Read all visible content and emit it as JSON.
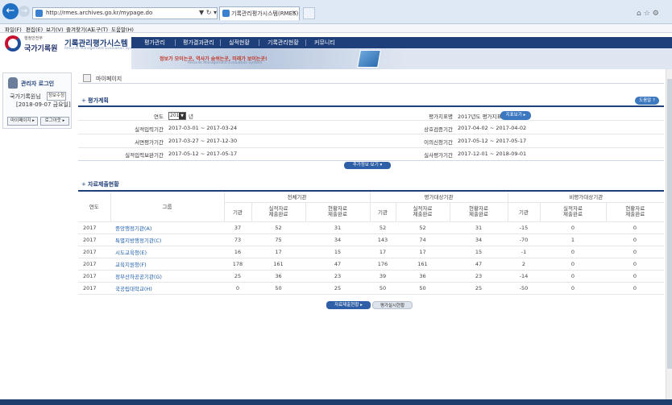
{
  "browser": {
    "url": "http://rmes.archives.go.kr/mypage.do",
    "addr_tools": "▼ ↻ ▾ ↺",
    "tab_title": "기록관리평가시스템(RMES)",
    "menu": [
      "파일(F)",
      "편집(E)",
      "보기(V)",
      "즐겨찾기(A)",
      "도구(T)",
      "도움말(H)"
    ],
    "window_icons": "⌂☆⚙"
  },
  "header": {
    "logo_top": "행정안전부",
    "logo_main": "국가기록원",
    "system_title": "기록관리평가시스템",
    "system_subtitle": "Records Management Evaluation System",
    "nav": [
      "평가관리",
      "평가결과관리",
      "실적현황",
      "기록관리현황",
      "커뮤니티"
    ],
    "banner_text": "정보가 모이는곳, 역사가 숨쉬는곳, 미래가 보이는곳!",
    "banner_sub": "Records Management Evaluation System"
  },
  "sidebar": {
    "title": "관리자 로그인",
    "user": "국가기록원님",
    "edit_label": "정보수정",
    "date": "[2018-09-07 금요일]",
    "mypage_label": "마이페이지 ▸",
    "logout_label": "로그아웃 ▸"
  },
  "page": {
    "title": "마이페이지",
    "help_label": "도움말 ?"
  },
  "eval_plan": {
    "section_title": "평가계획",
    "year_label": "연도",
    "year_value": "2017",
    "year_suffix": "년",
    "index_label": "평가지표명",
    "index_value": "2017년도 평가지표",
    "view_label": "지표보기 ▸",
    "left_rows": [
      {
        "label": "실적입력기간",
        "value": "2017-03-01 ~ 2017-03-24"
      },
      {
        "label": "서면평가기간",
        "value": "2017-03-27 ~ 2017-12-30"
      },
      {
        "label": "실적입력보완기간",
        "value": "2017-05-12 ~ 2017-05-17"
      }
    ],
    "right_rows": [
      {
        "label": "상호검증기간",
        "value": "2017-04-02 ~ 2017-04-02"
      },
      {
        "label": "이의신청기간",
        "value": "2017-05-12 ~ 2017-05-17"
      },
      {
        "label": "실사평가기간",
        "value": "2017-12-01 ~ 2018-09-01"
      }
    ],
    "more_label": "추가정보 보기 ▾"
  },
  "submission": {
    "section_title": "자료제출현황",
    "col_year": "연도",
    "col_group": "그룹",
    "groups": [
      "전체기관",
      "평가대상기관",
      "비평가대상기관"
    ],
    "sub_cols": [
      {
        "a": "기관",
        "b": ""
      },
      {
        "a": "실적자료",
        "b": "제출완료"
      },
      {
        "a": "현황자료",
        "b": "제출완료"
      }
    ],
    "rows": [
      {
        "year": "2017",
        "group": "중앙행정기관(A)",
        "v": [
          "37",
          "52",
          "31",
          "52",
          "52",
          "31",
          "-15",
          "0",
          "0"
        ]
      },
      {
        "year": "2017",
        "group": "특별지방행정기관(C)",
        "v": [
          "73",
          "75",
          "34",
          "143",
          "74",
          "34",
          "-70",
          "1",
          "0"
        ]
      },
      {
        "year": "2017",
        "group": "시도교육청(E)",
        "v": [
          "16",
          "17",
          "15",
          "17",
          "17",
          "15",
          "-1",
          "0",
          "0"
        ]
      },
      {
        "year": "2017",
        "group": "교육지원청(F)",
        "v": [
          "178",
          "161",
          "47",
          "176",
          "161",
          "47",
          "2",
          "0",
          "0"
        ]
      },
      {
        "year": "2017",
        "group": "정부산하공공기관(G)",
        "v": [
          "25",
          "36",
          "23",
          "39",
          "36",
          "23",
          "-14",
          "0",
          "0"
        ]
      },
      {
        "year": "2017",
        "group": "국공립대학교(H)",
        "v": [
          "0",
          "50",
          "25",
          "50",
          "50",
          "25",
          "-50",
          "0",
          "0"
        ]
      }
    ],
    "tab_submit": "자료제출현황 ▸",
    "tab_status": "평가실시현황"
  }
}
